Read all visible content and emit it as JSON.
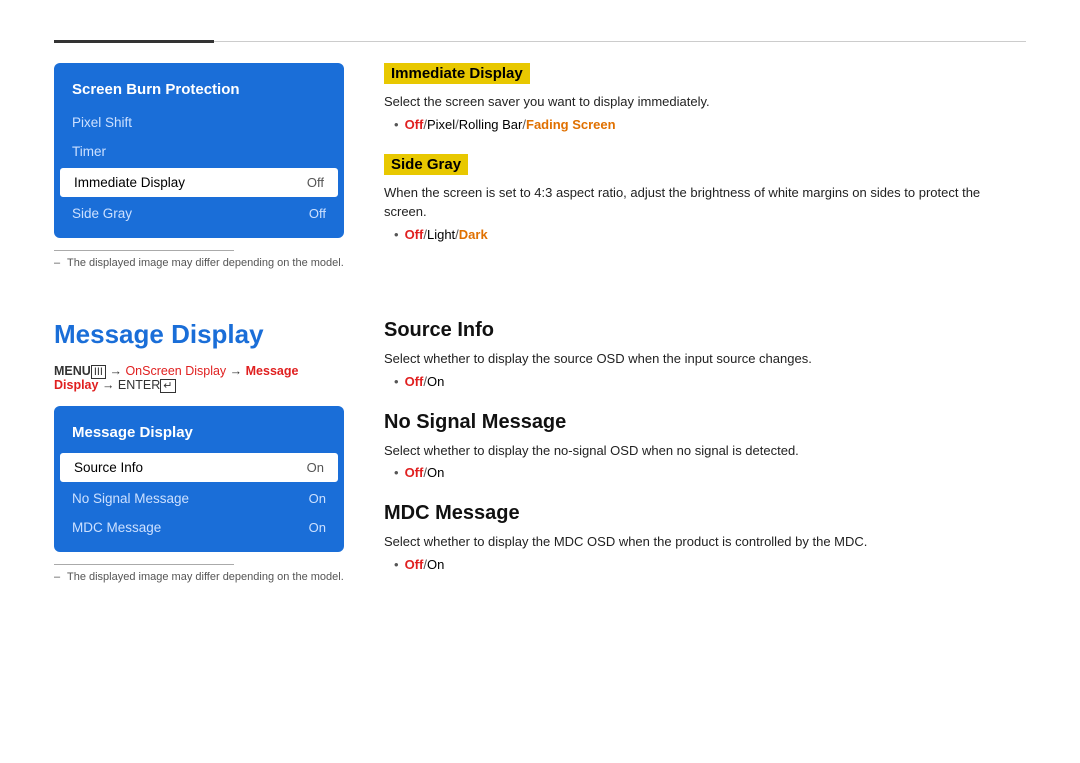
{
  "top_divider": true,
  "section1": {
    "menu_title": "Screen Burn Protection",
    "menu_items": [
      {
        "label": "Pixel Shift",
        "value": "",
        "selected": false
      },
      {
        "label": "Timer",
        "value": "",
        "selected": false
      },
      {
        "label": "Immediate Display",
        "value": "Off",
        "selected": true
      },
      {
        "label": "Side Gray",
        "value": "Off",
        "selected": false
      }
    ],
    "note": "The displayed image may differ depending on the model.",
    "right": {
      "blocks": [
        {
          "title": "Immediate Display",
          "desc": "Select the screen saver you want to display immediately.",
          "options": [
            {
              "text": "Off",
              "style": "red"
            },
            {
              "text": " / ",
              "style": "sep"
            },
            {
              "text": "Pixel",
              "style": "normal"
            },
            {
              "text": " / ",
              "style": "sep"
            },
            {
              "text": "Rolling Bar",
              "style": "normal"
            },
            {
              "text": " / ",
              "style": "sep"
            },
            {
              "text": "Fading Screen",
              "style": "orange"
            }
          ]
        },
        {
          "title": "Side Gray",
          "desc": "When the screen is set to 4:3 aspect ratio, adjust the brightness of white margins on sides to protect the screen.",
          "options": [
            {
              "text": "Off",
              "style": "red"
            },
            {
              "text": " / ",
              "style": "sep"
            },
            {
              "text": "Light",
              "style": "normal"
            },
            {
              "text": " / ",
              "style": "sep"
            },
            {
              "text": "Dark",
              "style": "orange"
            }
          ]
        }
      ]
    }
  },
  "section2": {
    "page_title": "Message Display",
    "menu_path": {
      "parts": [
        {
          "text": "MENU",
          "style": "bold"
        },
        {
          "text": "III",
          "style": "icon"
        },
        {
          "text": " → ",
          "style": "arrow"
        },
        {
          "text": "OnScreen Display",
          "style": "highlighted"
        },
        {
          "text": " → ",
          "style": "arrow"
        },
        {
          "text": "Message Display",
          "style": "highlighted-bold"
        },
        {
          "text": " → ENTER",
          "style": "arrow"
        },
        {
          "text": "↵",
          "style": "icon"
        }
      ]
    },
    "menu_title": "Message Display",
    "menu_items": [
      {
        "label": "Source Info",
        "value": "On",
        "selected": true
      },
      {
        "label": "No Signal Message",
        "value": "On",
        "selected": false
      },
      {
        "label": "MDC Message",
        "value": "On",
        "selected": false
      }
    ],
    "note": "The displayed image may differ depending on the model.",
    "right": {
      "blocks": [
        {
          "title": "Source Info",
          "desc": "Select whether to display the source OSD when the input source changes.",
          "options": [
            {
              "text": "Off",
              "style": "red"
            },
            {
              "text": " / ",
              "style": "sep"
            },
            {
              "text": "On",
              "style": "normal"
            }
          ]
        },
        {
          "title": "No Signal Message",
          "desc": "Select whether to display the no-signal OSD when no signal is detected.",
          "options": [
            {
              "text": "Off",
              "style": "red"
            },
            {
              "text": " / ",
              "style": "sep"
            },
            {
              "text": "On",
              "style": "normal"
            }
          ]
        },
        {
          "title": "MDC Message",
          "desc": "Select whether to display the MDC OSD when the product is controlled by the MDC.",
          "options": [
            {
              "text": "Off",
              "style": "red"
            },
            {
              "text": " / ",
              "style": "sep"
            },
            {
              "text": "On",
              "style": "normal"
            }
          ]
        }
      ]
    }
  }
}
